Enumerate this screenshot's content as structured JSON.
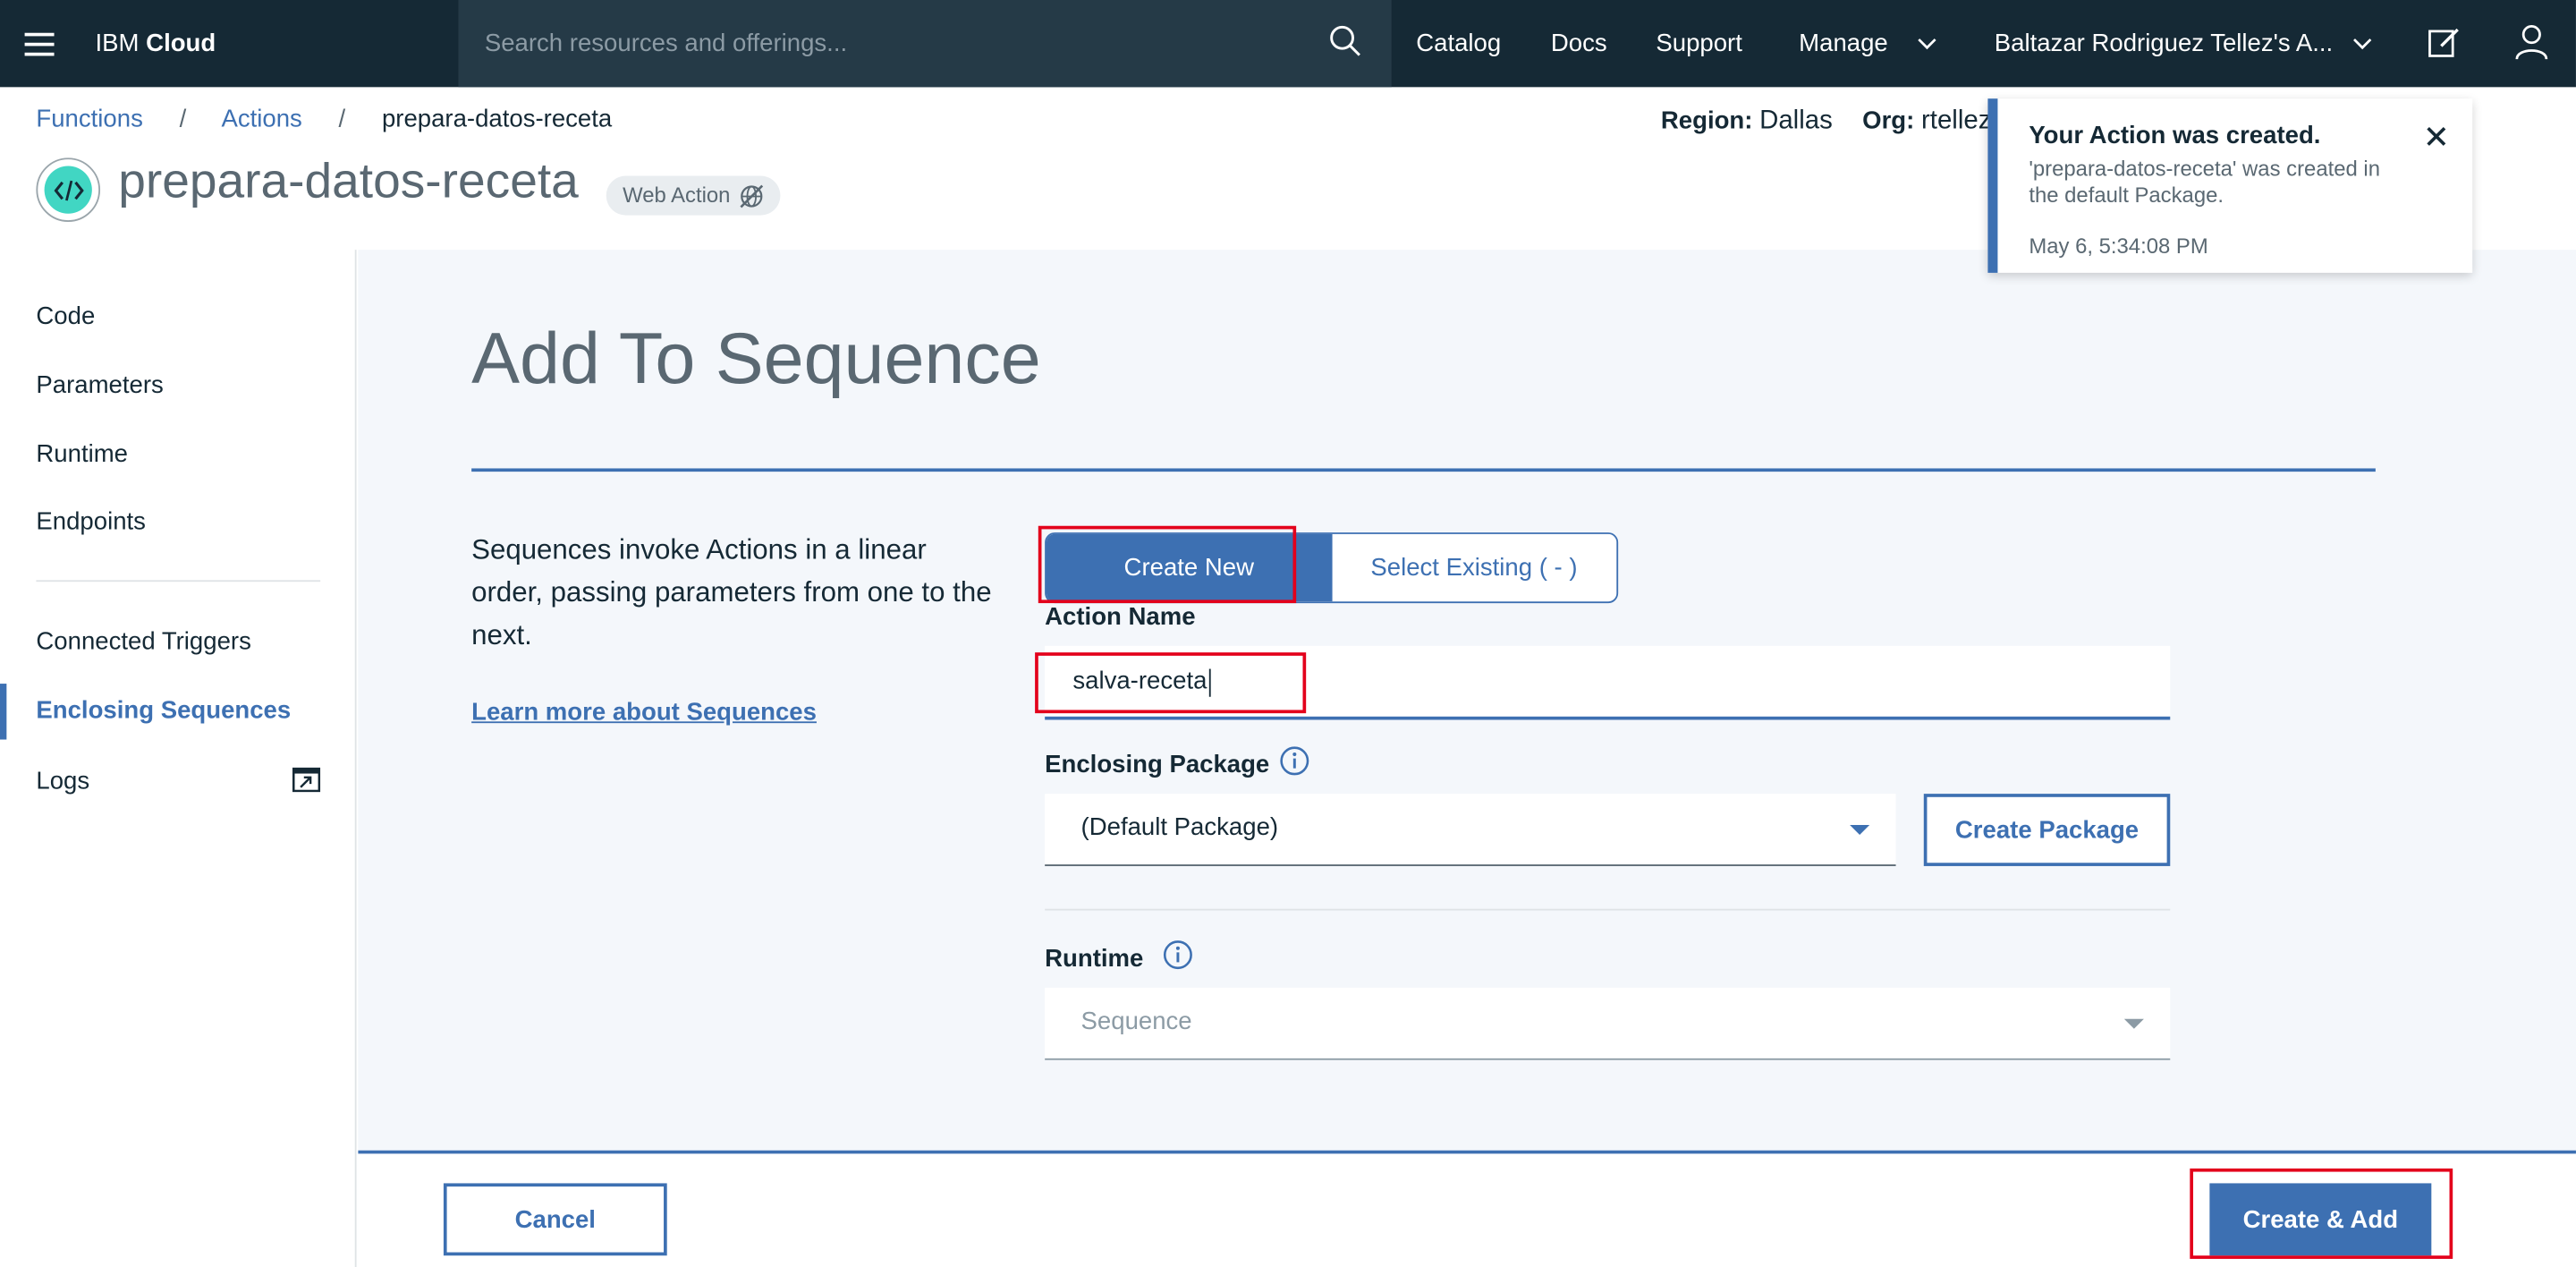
{
  "topbar": {
    "brand_prefix": "IBM",
    "brand_bold": "Cloud",
    "search_placeholder": "Search resources and offerings...",
    "nav": [
      "Catalog",
      "Docs",
      "Support",
      "Manage"
    ],
    "account": "Baltazar Rodriguez Tellez's A..."
  },
  "breadcrumb": {
    "items": [
      "Functions",
      "Actions"
    ],
    "current": "prepara-datos-receta",
    "separator": "/"
  },
  "header": {
    "title": "prepara-datos-receta",
    "tag": "Web Action",
    "region_label": "Region:",
    "region_value": "Dallas",
    "org_label": "Org:",
    "org_value": "rtellez"
  },
  "sidebar": {
    "items": [
      "Code",
      "Parameters",
      "Runtime",
      "Endpoints"
    ],
    "items2": [
      "Connected Triggers",
      "Enclosing Sequences",
      "Logs"
    ],
    "active": "Enclosing Sequences"
  },
  "main": {
    "title": "Add To Sequence",
    "description": "Sequences invoke Actions in a linear order, passing parameters from one to the next.",
    "learn_more": "Learn more about Sequences",
    "toggle": {
      "create_new": "Create New",
      "select_existing": "Select Existing ( - )",
      "selected": "Create New"
    },
    "action_name_label": "Action Name",
    "action_name_value": "salva-receta",
    "enclosing_package_label": "Enclosing Package",
    "enclosing_package_value": "(Default Package)",
    "create_package_label": "Create Package",
    "runtime_label": "Runtime",
    "runtime_value": "Sequence"
  },
  "footer": {
    "cancel": "Cancel",
    "create_add": "Create & Add"
  },
  "toast": {
    "title": "Your Action was created.",
    "body": "'prepara-datos-receta' was created in the default Package.",
    "time": "May 6, 5:34:08 PM"
  },
  "colors": {
    "topbar": "#152935",
    "accent": "#3d70b2",
    "highlight": "#e3001b",
    "action_icon": "#41d6c3"
  }
}
